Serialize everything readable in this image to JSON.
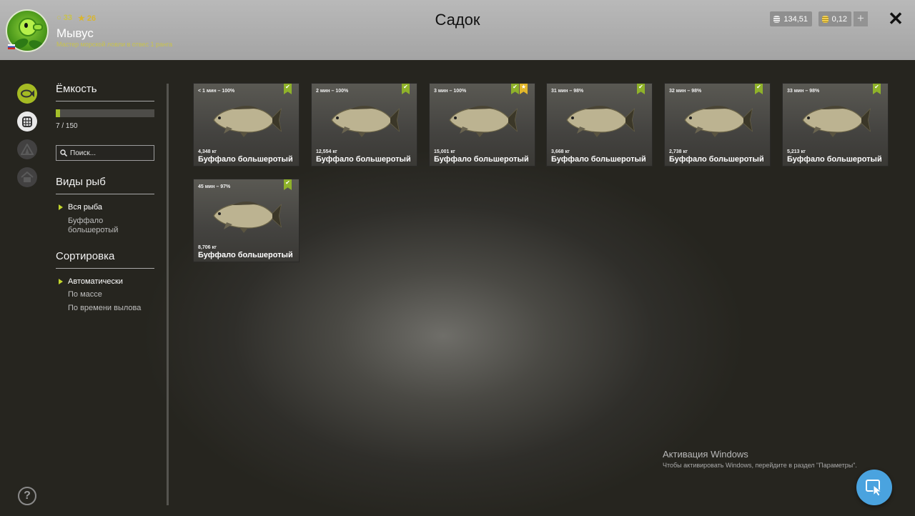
{
  "header": {
    "title": "Садок",
    "player": {
      "level": "33",
      "rank": "26",
      "name": "Мывус",
      "subtitle": "Мастер морской ловли в отвес 1 ранга"
    },
    "currency": {
      "silver": "134,51",
      "gold": "0,12",
      "add_label": "+"
    },
    "close_label": "✕"
  },
  "sidebar": {
    "nav_icons": [
      "fish-icon",
      "keepnet-icon",
      "tent-icon",
      "home-icon"
    ],
    "help_label": "?"
  },
  "filters": {
    "capacity": {
      "title": "Ёмкость",
      "used": 7,
      "max": 150,
      "text": "7 / 150"
    },
    "search": {
      "placeholder": "Поиск..."
    },
    "species": {
      "title": "Виды рыб",
      "options": [
        "Вся рыба",
        "Буффало большеротый"
      ],
      "selected": 0
    },
    "sort": {
      "title": "Сортировка",
      "options": [
        "Автоматически",
        "По массе",
        "По времени вылова"
      ],
      "selected": 0
    }
  },
  "fish_cards": [
    {
      "time": "< 1 мин – 100%",
      "weight": "4,348 кг",
      "name": "Буффало большеротый",
      "badges": [
        "check"
      ]
    },
    {
      "time": "2 мин – 100%",
      "weight": "12,554 кг",
      "name": "Буффало большеротый",
      "badges": [
        "check"
      ]
    },
    {
      "time": "3 мин – 100%",
      "weight": "15,001 кг",
      "name": "Буффало большеротый",
      "badges": [
        "check",
        "star"
      ]
    },
    {
      "time": "31 мин – 98%",
      "weight": "3,668 кг",
      "name": "Буффало большеротый",
      "badges": [
        "check"
      ]
    },
    {
      "time": "32 мин – 98%",
      "weight": "2,738 кг",
      "name": "Буффало большеротый",
      "badges": [
        "check"
      ]
    },
    {
      "time": "33 мин – 98%",
      "weight": "5,213 кг",
      "name": "Буффало большеротый",
      "badges": [
        "check"
      ]
    },
    {
      "time": "45 мин – 97%",
      "weight": "8,706 кг",
      "name": "Буффало большеротый",
      "badges": [
        "check"
      ]
    }
  ],
  "windows_activation": {
    "title": "Активация Windows",
    "subtitle": "Чтобы активировать Windows, перейдите в раздел \"Параметры\"."
  },
  "colors": {
    "accent": "#a5c02a",
    "header_bg": "#b0b0b0",
    "bookmark_gold": "#e2b72b",
    "fab_blue": "#4aa3df"
  }
}
